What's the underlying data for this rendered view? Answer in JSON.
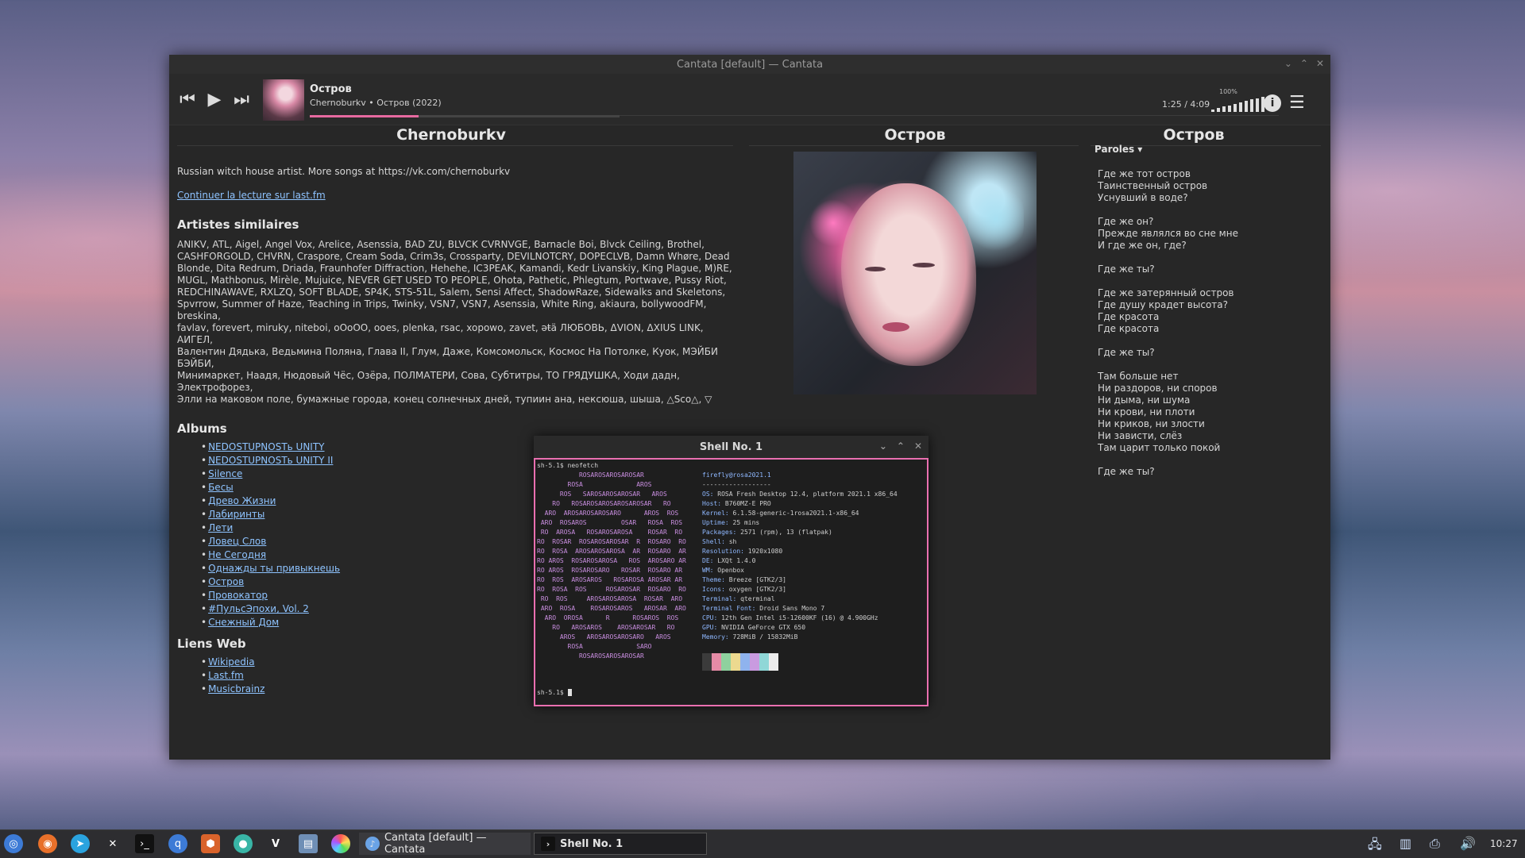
{
  "window": {
    "title": "Cantata [default] — Cantata"
  },
  "player": {
    "track_title": "Остров",
    "track_sub": "Chernoburkv • Остров (2022)",
    "progress": 0.35,
    "time": "1:25 / 4:09",
    "volume_label": "100%",
    "volume": 1.0,
    "icons": {
      "prev": "skip-back-icon",
      "play": "play-icon",
      "next": "skip-forward-icon",
      "info": "info-icon",
      "menu": "hamburger-menu-icon"
    }
  },
  "artist": {
    "heading": "Chernoburkv",
    "bio": "Russian witch house artist. More songs at https://vk.com/chernoburkv",
    "read_more": "Continuer la lecture sur last.fm",
    "similar_heading": "Artistes similaires",
    "similar_lines": [
      "ANIKV, ATL, Aigel, Angel Vox, Arelice, Asenssia, BAD ZU, BLVCK CVRNVGE, Barnacle Boi, Blvck Ceiling, Brothel,",
      "CASHFORGOLD, CHVRN, Craspore, Cream Soda, Crim3s, Crossparty, DEVILNOTCRY, DOPECLVB, Damn Whøre, Dead",
      "Blonde, Dita Redrum, Driada, Fraunhofer Diffraction, Hehehe, IC3PEAK, Kamandi, Kedr Livanskiy, King Plague, M)RE,",
      "MUGL, Mathbonus, Mirèle, Mujuice, NEVER GET USED TO PEOPLE, Ohota, Pathetic, Phlegtum, Portwave, Pussy Riot,",
      "REDCHINAWAVE, RXLZQ, SOFT BLADE, SP4K, STS-51L, Salem, Sensi Affect, ShadowRaze, Sidewalks and Skeletons,",
      "Spvrrow, Summer of Haze, Teaching in Trips, Twinky, VSN7, VSN7, Asenssia, White Ring, akiaura, bollywoodFM, breskina,",
      "favlav, forevert, miruky, niteboi, oOoOO, ooes, plenka, rsac, xopowo, zavet, əŧä ЛЮБОВЬ, ΔVION, ΔXIUS LINK, АИГЕЛ,",
      "Валентин Дядька, Ведьмина Поляна, Глава II, Глум, Даже, Комсомольск, Космос На Потолке, Куок, МЭЙБИ БЭЙБИ,",
      "Минимаркет, Нaадя, Нюдовый Чёс, Озёра, ПОЛМАТЕРИ, Сова, Субтитры, ТО ГРЯДУШКА, Ходи дадн, Электрофорез,",
      "Элли на маковом поле, бумажные города, конец солнечных дней, тупиин ана, нексюша, шыша, △Sco△, ▽"
    ],
    "albums_heading": "Albums",
    "albums": [
      "NEDOSTUPNOSTь UNITY",
      "NEDOSTUPNOSTь UNITY II",
      "Silence",
      "Бесы",
      "Древо Жизни",
      "Лабиринты",
      "Лети",
      "Ловец Слов",
      "Не Сегодня",
      "Однажды ты привыкнешь",
      "Остров",
      "Провокатор",
      "#ПульсЭпохи, Vol. 2",
      "Снежный Дом"
    ],
    "links_heading": "Liens Web",
    "links": [
      "Wikipedia",
      "Last.fm",
      "Musicbrainz"
    ]
  },
  "album": {
    "heading": "Остров"
  },
  "lyrics": {
    "heading": "Остров",
    "dropdown": "Paroles ▾",
    "stanzas": [
      [
        "Где же тот остров",
        "Таинственный остров",
        "Уснувший в воде?"
      ],
      [
        "Где же он?",
        "Прежде являлся во сне мне",
        "И где же он, где?"
      ],
      [
        "Где же ты?"
      ],
      [
        "Где же затерянный остров",
        "Где душу крадет высота?",
        "Где красота",
        "Где красота"
      ],
      [
        "Где же ты?"
      ],
      [
        "Там больше нет",
        "Ни раздоров, ни споров",
        "Ни дыма, ни шума",
        "Ни крови, ни плоти",
        "Ни криков, ни злости",
        "Ни зависти, слёз",
        "Там царит только покой"
      ],
      [
        "Где же ты?"
      ]
    ]
  },
  "shell": {
    "title": "Shell No. 1",
    "command": "sh-5.1$ neofetch",
    "ascii": [
      "           ROSAROSAROSAROSAR",
      "        ROSA              AROS",
      "      ROS   SAROSAROSAROSAR   AROS",
      "    RO   ROSAROSAROSAROSAROSAR   RO",
      "  ARO  AROSAROSAROSARO      AROS  ROS",
      " ARO  ROSAROS         OSAR   ROSA  ROS",
      " RO  AROSA   ROSAROSAROSA    ROSAR  RO",
      "RO  ROSAR  ROSAROSAROSAR  R  ROSARO  RO",
      "RO  ROSA  AROSAROSAROSA  AR  ROSARO  AR",
      "RO AROS  ROSAROSAROSA   ROS  AROSARO AR",
      "RO AROS  ROSAROSARO   ROSAR  ROSARO AR",
      "RO  ROS  AROSAROS   ROSAROSA AROSAR AR",
      "RO  ROSA  ROS     ROSAROSAR  ROSARO  RO",
      " RO  ROS     AROSAROSAROSA  ROSAR  ARO",
      " ARO  ROSA    ROSAROSAROS   AROSAR  ARO",
      "  ARO  OROSA      R      ROSAROS  ROS",
      "    RO   AROSAROS    AROSAROSAR   RO",
      "      AROS   AROSAROSAROSARO   AROS",
      "        ROSA              SARO",
      "           ROSAROSAROSAROSAR"
    ],
    "sysinfo": [
      {
        "k": "firefly@rosa2021.1",
        "v": ""
      },
      {
        "k": "",
        "v": "------------------"
      },
      {
        "k": "OS:",
        "v": " ROSA Fresh Desktop 12.4, platform 2021.1 x86_64"
      },
      {
        "k": "Host:",
        "v": " B760MZ-E PRO"
      },
      {
        "k": "Kernel:",
        "v": " 6.1.58-generic-1rosa2021.1-x86_64"
      },
      {
        "k": "Uptime:",
        "v": " 25 mins"
      },
      {
        "k": "Packages:",
        "v": " 2571 (rpm), 13 (flatpak)"
      },
      {
        "k": "Shell:",
        "v": " sh"
      },
      {
        "k": "Resolution:",
        "v": " 1920x1080"
      },
      {
        "k": "DE:",
        "v": " LXQt 1.4.0"
      },
      {
        "k": "WM:",
        "v": " Openbox"
      },
      {
        "k": "Theme:",
        "v": " Breeze [GTK2/3]"
      },
      {
        "k": "Icons:",
        "v": " oxygen [GTK2/3]"
      },
      {
        "k": "Terminal:",
        "v": " qterminal"
      },
      {
        "k": "Terminal Font:",
        "v": " Droid Sans Mono 7"
      },
      {
        "k": "CPU:",
        "v": " 12th Gen Intel i5-12600KF (16) @ 4.900GHz"
      },
      {
        "k": "GPU:",
        "v": " NVIDIA GeForce GTX 650"
      },
      {
        "k": "Memory:",
        "v": " 728MiB / 15832MiB"
      }
    ],
    "swatches": [
      "#3b3b3b",
      "#e58ba6",
      "#8fd19e",
      "#ecd98f",
      "#8fb3ee",
      "#c99be0",
      "#8fd7d7",
      "#ececec"
    ],
    "prompt": "sh-5.1$ "
  },
  "taskbar": {
    "launchers": [
      "rosa-menu-icon",
      "firefox-icon",
      "telegram-icon",
      "tools-icon",
      "terminal-icon",
      "qbittorrent-icon",
      "package-icon",
      "messenger-icon",
      "vivaldi-icon",
      "notes-icon",
      "color-picker-icon"
    ],
    "tasks": [
      "Cantata [default] — Cantata",
      "Shell No. 1"
    ],
    "tray": [
      "network-icon",
      "clipboard-icon",
      "printer-icon",
      "volume-icon"
    ],
    "clock": "10:27"
  }
}
